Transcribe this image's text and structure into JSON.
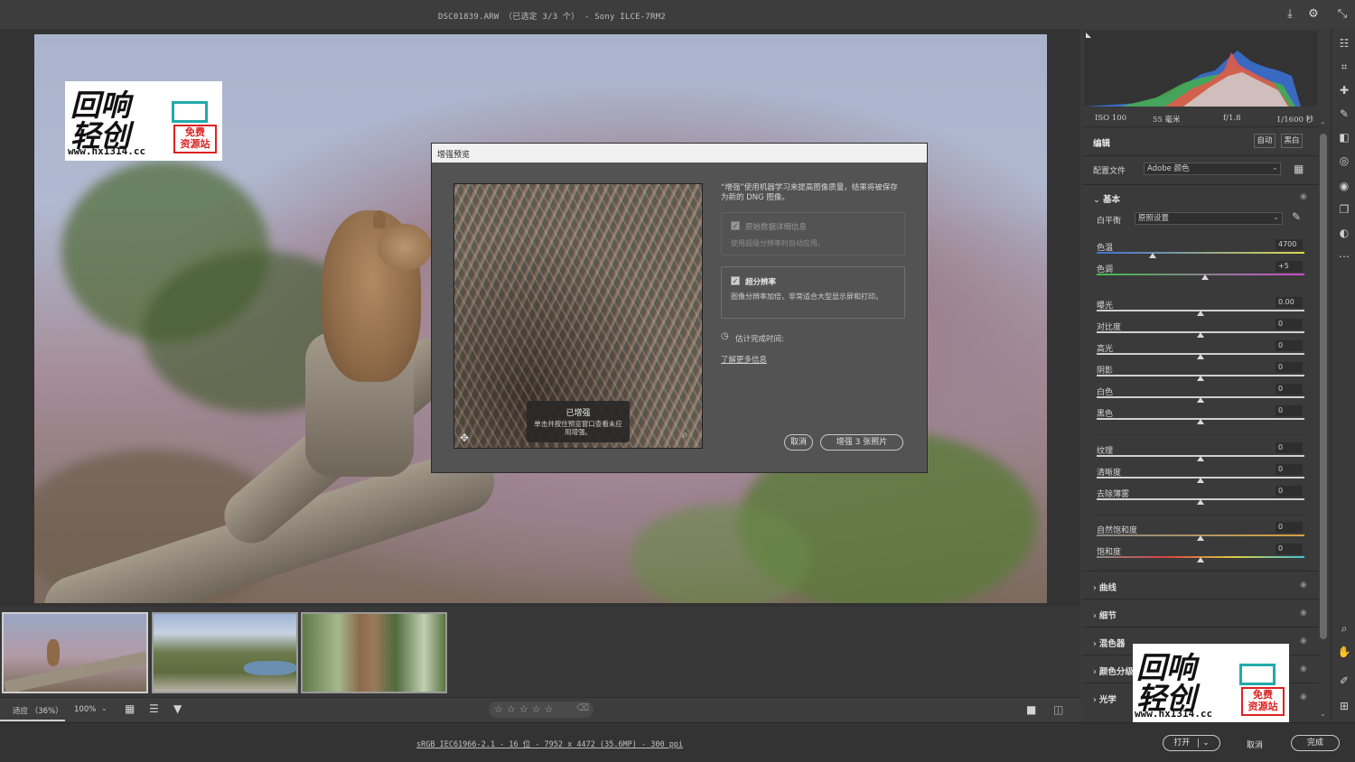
{
  "window": {
    "title": "DSC01839.ARW （已选定 3/3 个） - Sony ILCE-7RM2",
    "icons": [
      "save-icon",
      "gear-icon",
      "collapse-icon"
    ]
  },
  "watermark": {
    "line1": "回响",
    "line2": "轻创",
    "url": "www.hx1314.cc",
    "badge_line1": "免费",
    "badge_line2": "资源站"
  },
  "dialog": {
    "title": "增强预览",
    "badge_title": "已增强",
    "badge_desc": "单击并按住预览窗口查看未应用增强。",
    "description": "“增强”使用机器学习来提高图像质量，结果将被保存为新的 DNG 图像。",
    "option_raw_label": "原始数据详细信息",
    "option_raw_desc": "使用超级分辨率时自动应用。",
    "option_sr_label": "超分辨率",
    "option_sr_desc": "图像分辨率加倍，非常适合大型显示屏和打印。",
    "estimate_label": "估计完成时间:",
    "learn_more": "了解更多信息",
    "cancel": "取消",
    "enhance": "增强 3 张照片"
  },
  "bottombar": {
    "fit_label": "适应 （36%）",
    "zoom": "100%"
  },
  "status": {
    "info": "sRGB IEC61966-2.1 - 16 位 - 7952 x 4472 (35.6MP) - 300 ppi",
    "open": "打开",
    "cancel": "取消",
    "done": "完成"
  },
  "panel": {
    "exif": {
      "iso": "ISO 100",
      "focal": "55 毫米",
      "aperture": "f/1.8",
      "shutter": "1/1600 秒"
    },
    "edit_label": "编辑",
    "auto": "自动",
    "bw": "黑白",
    "profile_label": "配置文件",
    "profile_value": "Adobe 颜色",
    "basic": "基本",
    "wb_label": "白平衡",
    "wb_value": "原照设置",
    "sliders": [
      {
        "label": "色温",
        "value": "4700",
        "pos": 0.27
      },
      {
        "label": "色调",
        "value": "+5",
        "pos": 0.52
      },
      {
        "label": "曝光",
        "value": "0.00",
        "pos": 0.5
      },
      {
        "label": "对比度",
        "value": "0",
        "pos": 0.5
      },
      {
        "label": "高光",
        "value": "0",
        "pos": 0.5
      },
      {
        "label": "阴影",
        "value": "0",
        "pos": 0.5
      },
      {
        "label": "白色",
        "value": "0",
        "pos": 0.5
      },
      {
        "label": "黑色",
        "value": "0",
        "pos": 0.5
      },
      {
        "label": "纹理",
        "value": "0",
        "pos": 0.5
      },
      {
        "label": "清晰度",
        "value": "0",
        "pos": 0.5
      },
      {
        "label": "去除薄雾",
        "value": "0",
        "pos": 0.5
      },
      {
        "label": "自然饱和度",
        "value": "0",
        "pos": 0.5
      },
      {
        "label": "饱和度",
        "value": "0",
        "pos": 0.5
      }
    ],
    "sections": [
      "曲线",
      "细节",
      "混色器",
      "颜色分级",
      "光学"
    ]
  },
  "colors": {
    "accent": "#d0d0d0",
    "bg": "#3a3a3a"
  }
}
